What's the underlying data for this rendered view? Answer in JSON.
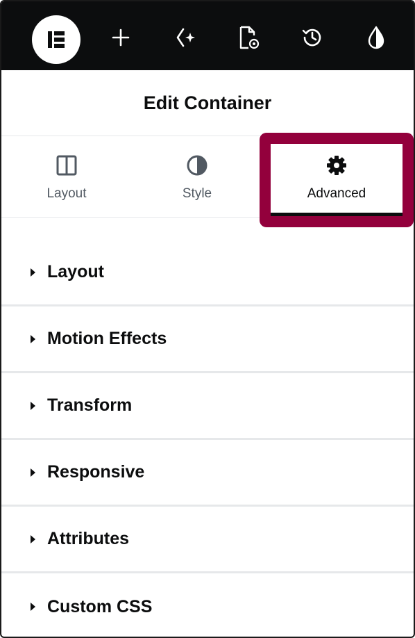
{
  "topbar": {
    "logo_icon": "elementor-logo-icon",
    "icons": [
      "add-icon",
      "ai-sparkle-icon",
      "page-settings-icon",
      "history-icon",
      "site-settings-drop-icon"
    ],
    "background": "#0c0d0e"
  },
  "panel": {
    "title": "Edit Container"
  },
  "tabs": [
    {
      "label": "Layout",
      "icon": "layout-columns-icon",
      "active": false
    },
    {
      "label": "Style",
      "icon": "contrast-half-circle-icon",
      "active": false
    },
    {
      "label": "Advanced",
      "icon": "gear-icon",
      "active": true
    }
  ],
  "highlight_color": "#93003c",
  "sections": [
    {
      "label": "Layout"
    },
    {
      "label": "Motion Effects"
    },
    {
      "label": "Transform"
    },
    {
      "label": "Responsive"
    },
    {
      "label": "Attributes"
    },
    {
      "label": "Custom CSS"
    }
  ]
}
